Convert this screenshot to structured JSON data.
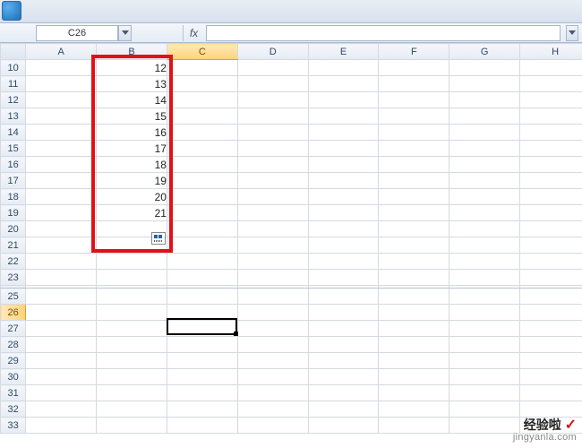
{
  "name_box": {
    "value": "C26"
  },
  "formula_bar": {
    "fx_label": "fx",
    "value": ""
  },
  "columns": [
    "A",
    "B",
    "C",
    "D",
    "E",
    "F",
    "G",
    "H"
  ],
  "active_column_index": 2,
  "rows_before_break": [
    10,
    11,
    12,
    13,
    14,
    15,
    16,
    17,
    18,
    19,
    20,
    21,
    22,
    23
  ],
  "rows_after_break": [
    25,
    26,
    27,
    28,
    29,
    30,
    31,
    32,
    33
  ],
  "active_row": 26,
  "selected_cell": "C26",
  "data_cells": {
    "10": {
      "B": "12"
    },
    "11": {
      "B": "13"
    },
    "12": {
      "B": "14"
    },
    "13": {
      "B": "15"
    },
    "14": {
      "B": "16"
    },
    "15": {
      "B": "17"
    },
    "16": {
      "B": "18"
    },
    "17": {
      "B": "19"
    },
    "18": {
      "B": "20"
    },
    "19": {
      "B": "21"
    }
  },
  "highlight": {
    "col_start": "B",
    "row_start": 10,
    "row_end": 20
  },
  "autofill_options": {
    "visible": true,
    "near_row": 20
  },
  "watermark": {
    "line1": "经验啦",
    "check": "✓",
    "line2": "jingyanla.com"
  },
  "chart_data": {
    "type": "table",
    "title": "",
    "columns": [
      "A",
      "B",
      "C",
      "D",
      "E",
      "F",
      "G",
      "H"
    ],
    "rows": [
      {
        "row": 10,
        "B": 12
      },
      {
        "row": 11,
        "B": 13
      },
      {
        "row": 12,
        "B": 14
      },
      {
        "row": 13,
        "B": 15
      },
      {
        "row": 14,
        "B": 16
      },
      {
        "row": 15,
        "B": 17
      },
      {
        "row": 16,
        "B": 18
      },
      {
        "row": 17,
        "B": 19
      },
      {
        "row": 18,
        "B": 20
      },
      {
        "row": 19,
        "B": 21
      }
    ],
    "selected": "C26"
  }
}
